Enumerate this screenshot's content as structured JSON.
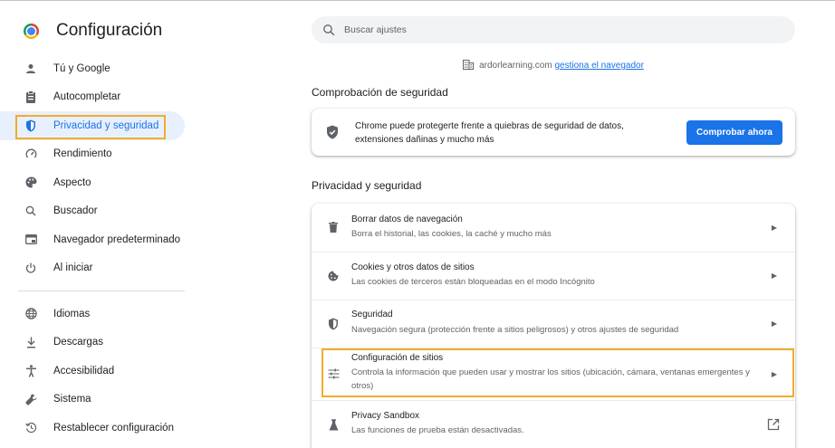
{
  "app": {
    "title": "Configuración"
  },
  "sidebar": {
    "items": [
      {
        "label": "Tú y Google",
        "icon": "person-icon"
      },
      {
        "label": "Autocompletar",
        "icon": "clipboard-icon"
      },
      {
        "label": "Privacidad y seguridad",
        "icon": "shield-icon",
        "active": true
      },
      {
        "label": "Rendimiento",
        "icon": "speedometer-icon"
      },
      {
        "label": "Aspecto",
        "icon": "palette-icon"
      },
      {
        "label": "Buscador",
        "icon": "search-icon"
      },
      {
        "label": "Navegador predeterminado",
        "icon": "browser-icon"
      },
      {
        "label": "Al iniciar",
        "icon": "power-icon"
      }
    ],
    "items2": [
      {
        "label": "Idiomas",
        "icon": "globe-icon"
      },
      {
        "label": "Descargas",
        "icon": "download-icon"
      },
      {
        "label": "Accesibilidad",
        "icon": "accessibility-icon"
      },
      {
        "label": "Sistema",
        "icon": "wrench-icon"
      },
      {
        "label": "Restablecer configuración",
        "icon": "restore-icon"
      }
    ]
  },
  "search": {
    "placeholder": "Buscar ajustes",
    "value": ""
  },
  "managed": {
    "domain": "ardorlearning.com",
    "link": "gestiona el navegador"
  },
  "safety_check": {
    "section_title": "Comprobación de seguridad",
    "description": "Chrome puede protegerte frente a quiebras de seguridad de datos, extensiones dañinas y mucho más",
    "button": "Comprobar ahora"
  },
  "privacy": {
    "section_title": "Privacidad y seguridad",
    "rows": [
      {
        "title": "Borrar datos de navegación",
        "subtitle": "Borra el historial, las cookies, la caché y mucho más",
        "icon": "trash-icon"
      },
      {
        "title": "Cookies y otros datos de sitios",
        "subtitle": "Las cookies de terceros están bloqueadas en el modo Incógnito",
        "icon": "cookie-icon"
      },
      {
        "title": "Seguridad",
        "subtitle": "Navegación segura (protección frente a sitios peligrosos) y otros ajustes de seguridad",
        "icon": "shield-icon"
      },
      {
        "title": "Configuración de sitios",
        "subtitle": "Controla la información que pueden usar y mostrar los sitios (ubicación, cámara, ventanas emergentes y otros)",
        "icon": "sliders-icon"
      },
      {
        "title": "Privacy Sandbox",
        "subtitle": "Las funciones de prueba están desactivadas.",
        "icon": "flask-icon"
      }
    ]
  },
  "colors": {
    "accent": "#1a73e8",
    "highlight": "#f0ad2a",
    "active_bg": "#e8f0fe"
  }
}
